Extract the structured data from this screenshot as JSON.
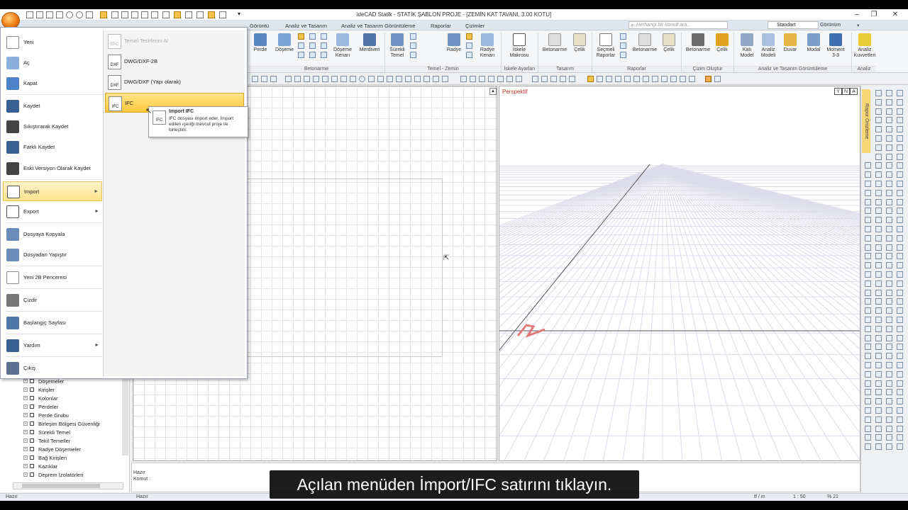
{
  "titlebar": {
    "title": "ideCAD Statik - STATİK ŞABLON PROJE - [ZEMİN KAT TAVANI,  3.00 KOTU]",
    "minimize": "–",
    "maximize": "❐",
    "close": "✕"
  },
  "tabs": [
    {
      "label": "Görüntü"
    },
    {
      "label": "Analiz ve Tasarım"
    },
    {
      "label": "Analiz ve Tasarım Görüntüleme"
    },
    {
      "label": "Raporlar"
    },
    {
      "label": "Çizimler"
    }
  ],
  "search": {
    "placeholder": "Herhangi bir komut ara..."
  },
  "style_dropdown": {
    "value": "Standart"
  },
  "gorunum_label": "Görünüm",
  "ribbon": {
    "buttons": [
      {
        "label": "Perde"
      },
      {
        "label": "Döşeme"
      },
      {
        "label": "Döşeme Kenarı"
      },
      {
        "label": "Merdiven"
      },
      {
        "label": "Sürekli Temel"
      },
      {
        "label": "Radye"
      },
      {
        "label": "Radye Kenarı"
      },
      {
        "label": "İskele Makrosu"
      },
      {
        "label": "Betonarme"
      },
      {
        "label": "Çelik"
      },
      {
        "label": "Seçmeli Raporlar"
      },
      {
        "label": "Betonarme"
      },
      {
        "label": "Çelik"
      },
      {
        "label": "Betonarme"
      },
      {
        "label": "Çelik"
      },
      {
        "label": "Katı Model"
      },
      {
        "label": "Analiz Modeli"
      },
      {
        "label": "Duvar"
      },
      {
        "label": "Modal"
      },
      {
        "label": "Moment 3-3"
      },
      {
        "label": "Analiz Kuvvetleri"
      }
    ],
    "groups": [
      {
        "label": "Betonarme"
      },
      {
        "label": "Temel - Zemin"
      },
      {
        "label": "İskele Ayarları"
      },
      {
        "label": "Tasarım"
      },
      {
        "label": "Raporlar"
      },
      {
        "label": "Çizim Oluştur"
      },
      {
        "label": "Analiz ve Tasarım Görüntüleme"
      },
      {
        "label": "Analiz"
      }
    ]
  },
  "app_menu": {
    "left_items": [
      {
        "label": "Yeni",
        "icon": "new-doc-icon"
      },
      {
        "label": "Aç",
        "icon": "open-folder-icon"
      },
      {
        "label": "Kapat",
        "icon": "close-folder-icon"
      },
      {
        "label": "Kaydet",
        "icon": "save-icon"
      },
      {
        "label": "Sıkıştırarak Kaydet",
        "icon": "save-compress-icon"
      },
      {
        "label": "Farklı Kaydet",
        "icon": "save-as-icon"
      },
      {
        "label": "Eski Versiyon Olarak Kaydet",
        "icon": "save-old-icon"
      },
      {
        "label": "Import",
        "icon": "import-icon"
      },
      {
        "label": "Export",
        "icon": "export-icon"
      },
      {
        "label": "Dosyaya Kopyala",
        "icon": "copy-to-file-icon"
      },
      {
        "label": "Dosyadan Yapıştır",
        "icon": "paste-from-file-icon"
      },
      {
        "label": "Yeni 2B Penceresi",
        "icon": "new-2d-window-icon"
      },
      {
        "label": "Çizdir",
        "icon": "print-icon"
      },
      {
        "label": "Başlangıç Sayfası",
        "icon": "home-icon"
      },
      {
        "label": "Yardım",
        "icon": "help-icon"
      },
      {
        "label": "Çıkış",
        "icon": "exit-icon"
      }
    ],
    "right_items": [
      {
        "label": "Temel Tesirlerini Al",
        "icon_text": "EFC"
      },
      {
        "label": "DWG/DXF-2B",
        "icon_text": "DXF"
      },
      {
        "label": "DWG/DXF (Yapı olarak)",
        "icon_text": "DXF"
      },
      {
        "label": "IFC",
        "icon_text": "IFC"
      }
    ]
  },
  "tooltip": {
    "title": "Import IFC",
    "body": "IFC dosyası import eder. İmport edilen içeriği mevcut proje ile birleştirir.",
    "icon_text": "IFC"
  },
  "tree": {
    "items": [
      {
        "label": "Döşemeler"
      },
      {
        "label": "Kirişler"
      },
      {
        "label": "Kolonlar"
      },
      {
        "label": "Perdeler"
      },
      {
        "label": "Perde Grubu"
      },
      {
        "label": "Birleşim Bölgesi Güvenliği"
      },
      {
        "label": "Sürekli Temel"
      },
      {
        "label": "Tekil Temeller"
      },
      {
        "label": "Radye Döşemeler"
      },
      {
        "label": "Bağ Kirişleri"
      },
      {
        "label": "Kazıklar"
      },
      {
        "label": "Deprem İzolatörleri"
      }
    ]
  },
  "viewport_3d": {
    "label": "Perspektif",
    "nav": [
      "Y",
      "N",
      "A"
    ]
  },
  "rapor_panel": {
    "label": "Rapor Önizleme"
  },
  "command": {
    "status": "Hazır",
    "prompt": "Komut :"
  },
  "statusbar": {
    "left": "Hazır",
    "units": "tf / m",
    "scale": "1 : 50",
    "zoom": "% 21"
  },
  "subtitle": "Açılan menüden İmport/IFC satırını tıklayın."
}
